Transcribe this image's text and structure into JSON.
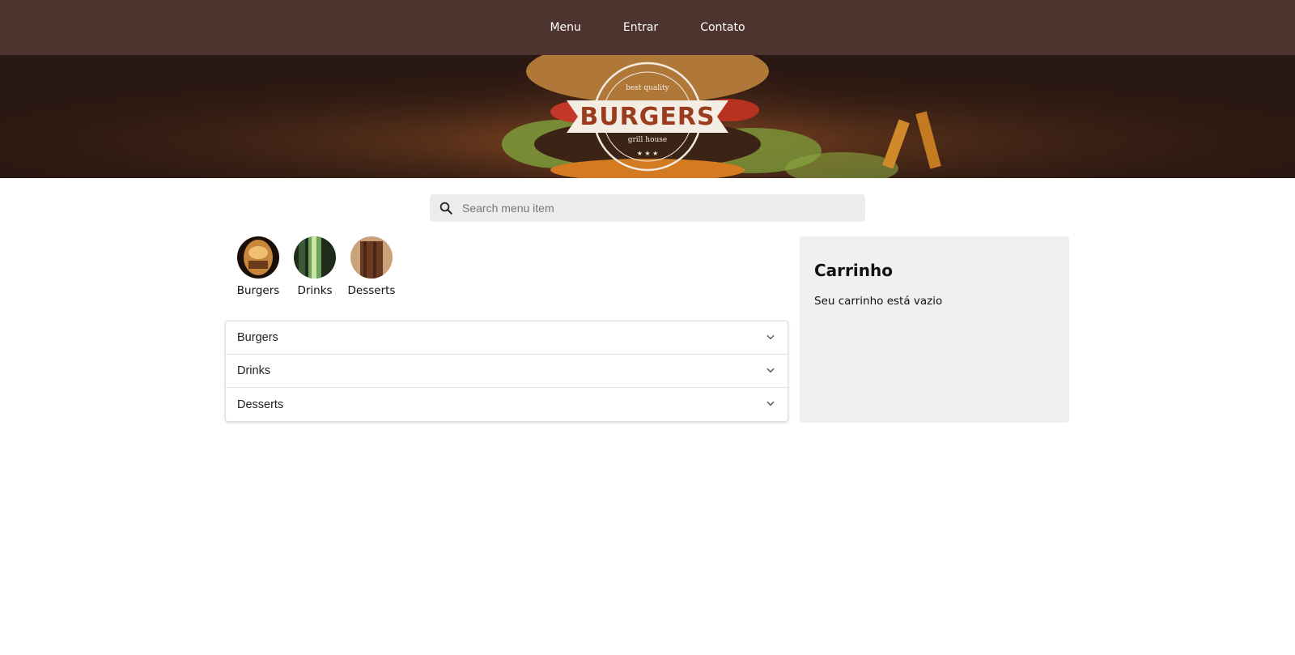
{
  "nav": {
    "items": [
      "Menu",
      "Entrar",
      "Contato"
    ]
  },
  "hero": {
    "logo_word": "BURGERS",
    "logo_top": "best quality",
    "logo_bottom": "grill house"
  },
  "search": {
    "placeholder": "Search menu item",
    "value": ""
  },
  "categories": [
    {
      "label": "Burgers"
    },
    {
      "label": "Drinks"
    },
    {
      "label": "Desserts"
    }
  ],
  "accordion": [
    {
      "label": "Burgers"
    },
    {
      "label": "Drinks"
    },
    {
      "label": "Desserts"
    }
  ],
  "cart": {
    "title": "Carrinho",
    "empty_text": "Seu carrinho está vazio"
  },
  "colors": {
    "nav_bg": "#4e342e",
    "cart_bg": "#f0f0f0",
    "search_bg": "#ececec"
  }
}
